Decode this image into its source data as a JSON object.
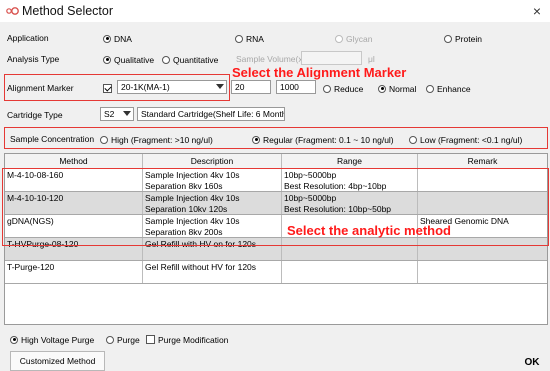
{
  "window": {
    "title": "Method Selector",
    "close": "×"
  },
  "application": {
    "label": "Application",
    "options": [
      "DNA",
      "RNA",
      "Glycan",
      "Protein"
    ],
    "selected": "DNA"
  },
  "analysis_type": {
    "label": "Analysis Type",
    "options": [
      "Qualitative",
      "Quantitative"
    ],
    "selected": "Qualitative",
    "sample_volume_label": "Sample Volume(x) :",
    "sample_volume_value": "",
    "sample_volume_unit": "μl"
  },
  "alignment_marker": {
    "label": "Alignment Marker",
    "checked": true,
    "selected": "20-1K(MA-1)",
    "low": "20",
    "high": "1000",
    "mode_options": [
      "Reduce",
      "Normal",
      "Enhance"
    ],
    "mode_selected": "Normal"
  },
  "cartridge": {
    "label": "Cartridge Type",
    "selected": "S2",
    "description": "Standard Cartridge(Shelf Life: 6 Months)"
  },
  "sample_concentration": {
    "label": "Sample Concentration",
    "options": [
      "High (Fragment: >10 ng/ul)",
      "Regular (Fragment: 0.1 ~ 10 ng/ul)",
      "Low (Fragment: <0.1 ng/ul)"
    ],
    "selected": "Regular (Fragment: 0.1 ~ 10 ng/ul)"
  },
  "annotations": {
    "alignment": "Select the Alignment Marker",
    "method": "Select the analytic method"
  },
  "table": {
    "columns": [
      "Method",
      "Description",
      "Range",
      "Remark"
    ],
    "rows": [
      {
        "method": "M-4-10-08-160",
        "desc1": "Sample Injection 4kv 10s",
        "desc2": "Separation 8kv 160s",
        "range1": "10bp~5000bp",
        "range2": "Best Resolution: 4bp~10bp",
        "remark": ""
      },
      {
        "method": "M-4-10-10-120",
        "desc1": "Sample Injection 4kv 10s",
        "desc2": "Separation 10kv 120s",
        "range1": "10bp~5000bp",
        "range2": "Best Resolution: 10bp~50bp",
        "remark": ""
      },
      {
        "method": "gDNA(NGS)",
        "desc1": "Sample Injection 4kv 10s",
        "desc2": "Separation 8kv 200s",
        "range1": "",
        "range2": "",
        "remark": "Sheared Genomic DNA"
      },
      {
        "method": "T-HVPurge-08-120",
        "desc1": "Gel Refill with HV on for 120s",
        "desc2": "",
        "range1": "",
        "range2": "",
        "remark": ""
      },
      {
        "method": "T-Purge-120",
        "desc1": "Gel Refill without HV for 120s",
        "desc2": "",
        "range1": "",
        "range2": "",
        "remark": ""
      }
    ]
  },
  "purge": {
    "options": [
      "High Voltage Purge",
      "Purge"
    ],
    "selected": "High Voltage Purge",
    "modification_label": "Purge Modification",
    "modification_checked": false
  },
  "footer": {
    "customized": "Customized Method",
    "ok": "OK"
  },
  "colors": {
    "annotation": "#ff1a1a",
    "highlight_box": "#e53935",
    "row_alt": "#dcdcdc"
  }
}
